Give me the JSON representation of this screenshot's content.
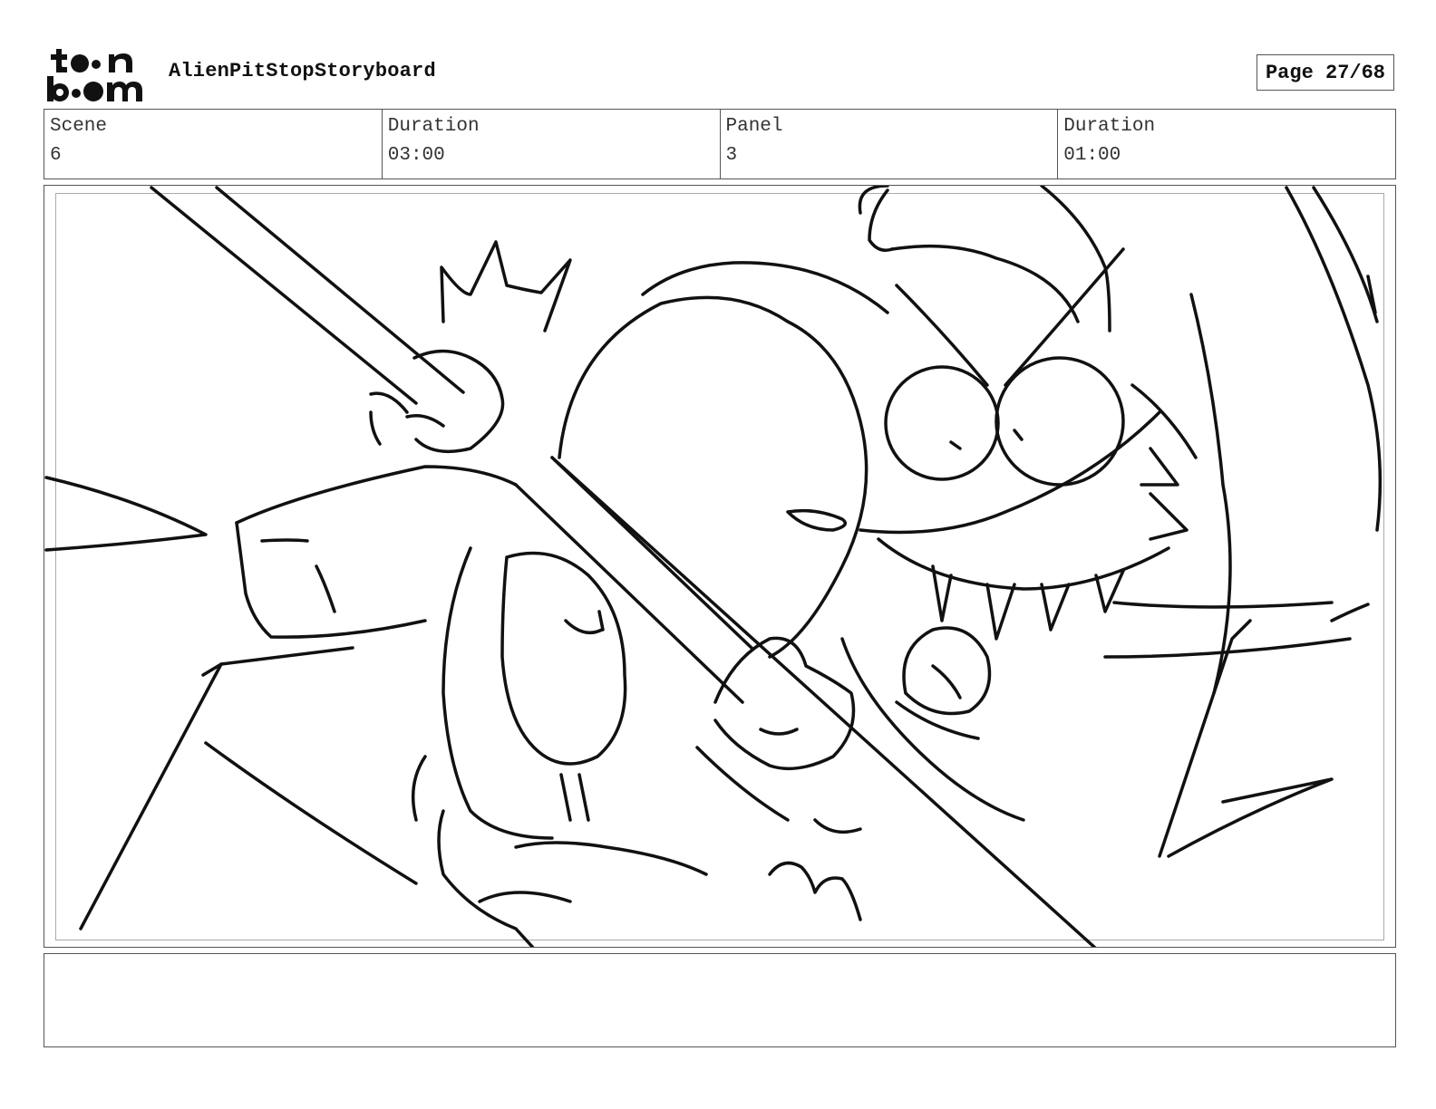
{
  "logo": {
    "line1": "toon",
    "line2": "boom",
    "icon": "toon-boom-logo"
  },
  "header": {
    "project_title": "AlienPitStopStoryboard",
    "page_label": "Page 27/68"
  },
  "info": {
    "scene_label": "Scene",
    "scene_value": "6",
    "scene_duration_label": "Duration",
    "scene_duration_value": "03:00",
    "panel_label": "Panel",
    "panel_value": "3",
    "panel_duration_label": "Duration",
    "panel_duration_value": "01:00"
  },
  "panel": {
    "image": "storyboard-sketch-two-aliens-fighting-over-pole"
  },
  "notes": {
    "text": ""
  }
}
